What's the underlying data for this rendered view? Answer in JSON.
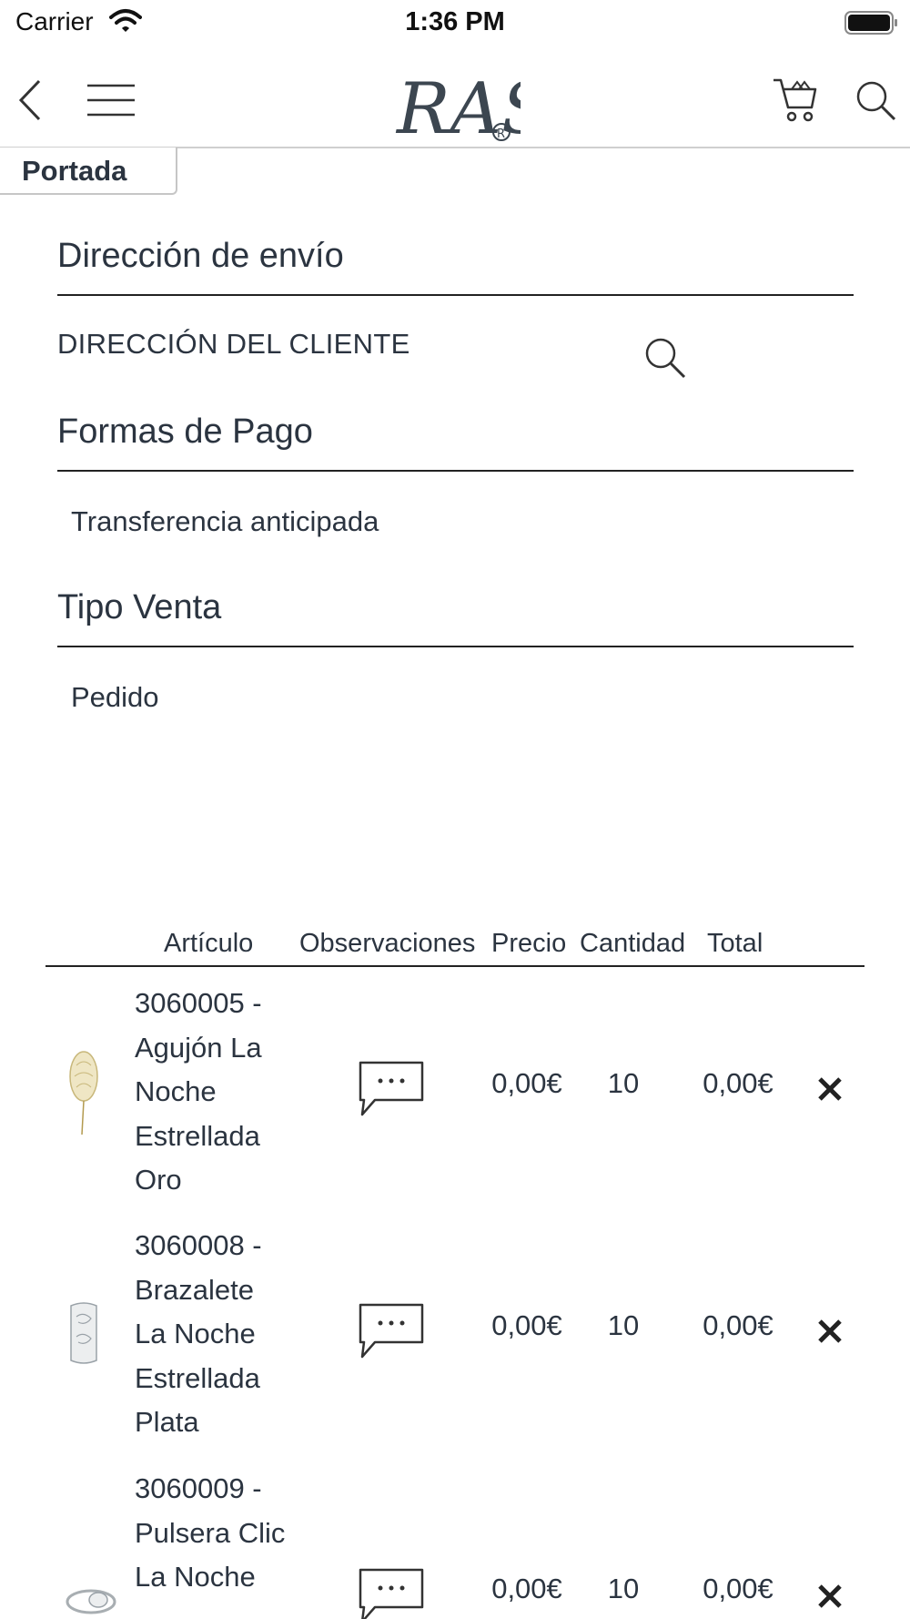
{
  "status_bar": {
    "carrier": "Carrier",
    "time": "1:36 PM",
    "icons": [
      "wifi-icon",
      "battery-icon"
    ]
  },
  "nav": {
    "logo_text": "RAS",
    "logo_mark": "®",
    "icons": [
      "back-icon",
      "menu-icon",
      "cart-icon",
      "search-icon"
    ]
  },
  "breadcrumb": {
    "label": "Portada"
  },
  "shipping": {
    "title": "Dirección de envío",
    "value": "DIRECCIÓN DEL CLIENTE"
  },
  "payment": {
    "title": "Formas de Pago",
    "value": "Transferencia anticipada"
  },
  "sale_type": {
    "title": "Tipo Venta",
    "value": "Pedido"
  },
  "table": {
    "columns": [
      "Artículo",
      "Observaciones",
      "Precio",
      "Cantidad",
      "Total"
    ],
    "rows": [
      {
        "article": "3060005 - Agujón La Noche Estrellada Oro",
        "price": "0,00€",
        "quantity": "10",
        "total": "0,00€",
        "thumb_icon": "hairpin-gold-thumb"
      },
      {
        "article": "3060008 - Brazalete La Noche Estrellada Plata",
        "price": "0,00€",
        "quantity": "10",
        "total": "0,00€",
        "thumb_icon": "cuff-silver-thumb"
      },
      {
        "article": "3060009 - Pulsera Clic La Noche",
        "price": "0,00€",
        "quantity": "10",
        "total": "0,00€",
        "thumb_icon": "bracelet-silver-thumb"
      }
    ]
  },
  "colors": {
    "text": "#2b3440",
    "divider": "#222222",
    "border": "#c6c6c6",
    "background": "#ffffff"
  }
}
